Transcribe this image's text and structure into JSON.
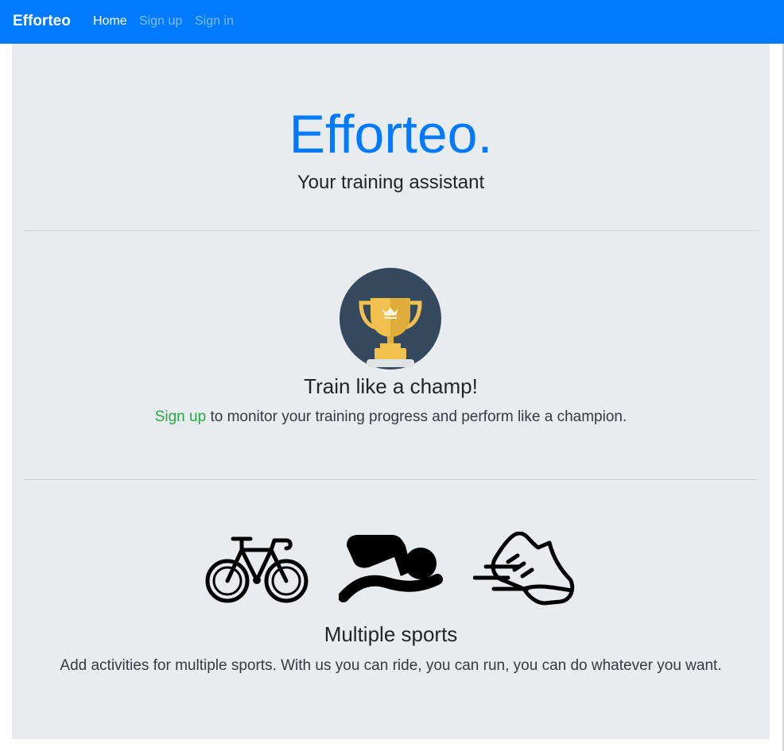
{
  "nav": {
    "brand": "Efforteo",
    "links": [
      {
        "label": "Home"
      },
      {
        "label": "Sign up"
      },
      {
        "label": "Sign in"
      }
    ]
  },
  "hero": {
    "title": "Efforteo.",
    "subtitle": "Your training assistant"
  },
  "champ": {
    "icon": "trophy-icon",
    "title": "Train like a champ!",
    "link_text": "Sign up",
    "text": " to monitor your training progress and perform like a champion."
  },
  "sports": {
    "icons": [
      "bicycle-icon",
      "swimmer-icon",
      "running-shoe-icon"
    ],
    "title": "Multiple sports",
    "text": "Add activities for multiple sports. With us you can ride, you can run, you can do whatever you want."
  },
  "colors": {
    "primary": "#007bff",
    "success": "#28a745",
    "jumbotron": "#e9ecef",
    "trophy_bg": "#34495e",
    "trophy_gold": "#f2c04e"
  }
}
